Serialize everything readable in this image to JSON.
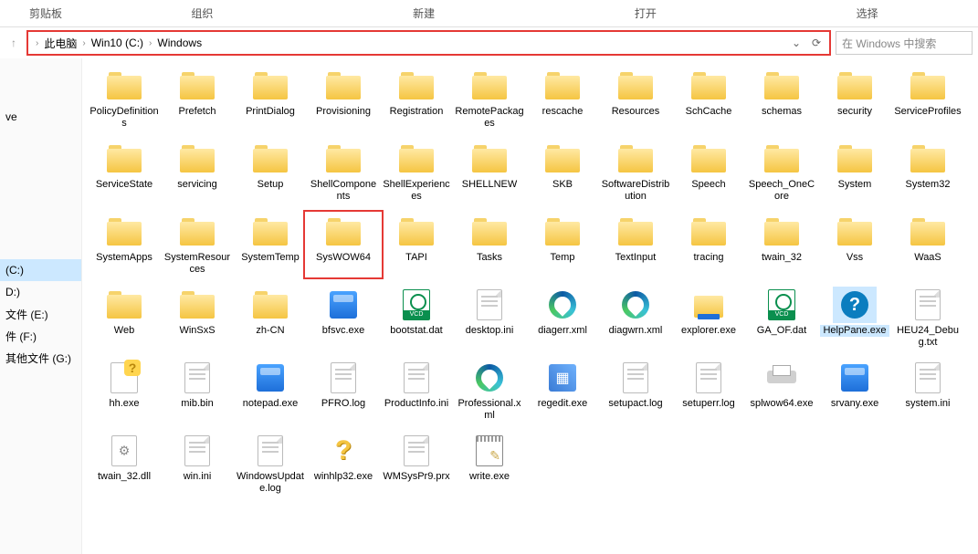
{
  "ribbon": {
    "left": "剪贴板",
    "groups": [
      "组织",
      "新建",
      "打开",
      "选择"
    ]
  },
  "nav": {
    "up": "↑"
  },
  "breadcrumb": [
    {
      "label": "此电脑"
    },
    {
      "label": "Win10 (C:)"
    },
    {
      "label": "Windows"
    }
  ],
  "search": {
    "placeholder": "在 Windows 中搜索"
  },
  "sidebar": [
    {
      "label": ""
    },
    {
      "label": ""
    },
    {
      "label": "ve"
    },
    {
      "label": ""
    },
    {
      "label": ""
    },
    {
      "label": ""
    },
    {
      "label": ""
    },
    {
      "label": ""
    },
    {
      "label": ""
    },
    {
      "label": "(C:)",
      "selected": true
    },
    {
      "label": "D:)"
    },
    {
      "label": "文件 (E:)"
    },
    {
      "label": "件 (F:)"
    },
    {
      "label": "其他文件 (G:)"
    }
  ],
  "items": [
    {
      "name": "PolicyDefinitions",
      "icon": "folder"
    },
    {
      "name": "Prefetch",
      "icon": "folder"
    },
    {
      "name": "PrintDialog",
      "icon": "folder"
    },
    {
      "name": "Provisioning",
      "icon": "folder"
    },
    {
      "name": "Registration",
      "icon": "folder"
    },
    {
      "name": "RemotePackages",
      "icon": "folder"
    },
    {
      "name": "rescache",
      "icon": "folder"
    },
    {
      "name": "Resources",
      "icon": "folder"
    },
    {
      "name": "SchCache",
      "icon": "folder"
    },
    {
      "name": "schemas",
      "icon": "folder"
    },
    {
      "name": "security",
      "icon": "folder"
    },
    {
      "name": "ServiceProfiles",
      "icon": "folder"
    },
    {
      "name": "ServiceState",
      "icon": "folder"
    },
    {
      "name": "servicing",
      "icon": "folder"
    },
    {
      "name": "Setup",
      "icon": "folder"
    },
    {
      "name": "ShellComponents",
      "icon": "folder"
    },
    {
      "name": "ShellExperiences",
      "icon": "folder"
    },
    {
      "name": "SHELLNEW",
      "icon": "folder"
    },
    {
      "name": "SKB",
      "icon": "folder"
    },
    {
      "name": "SoftwareDistribution",
      "icon": "folder"
    },
    {
      "name": "Speech",
      "icon": "folder"
    },
    {
      "name": "Speech_OneCore",
      "icon": "folder"
    },
    {
      "name": "System",
      "icon": "folder"
    },
    {
      "name": "System32",
      "icon": "folder"
    },
    {
      "name": "SystemApps",
      "icon": "folder"
    },
    {
      "name": "SystemResources",
      "icon": "folder"
    },
    {
      "name": "SystemTemp",
      "icon": "folder"
    },
    {
      "name": "SysWOW64",
      "icon": "folder",
      "highlight": true
    },
    {
      "name": "TAPI",
      "icon": "folder"
    },
    {
      "name": "Tasks",
      "icon": "folder"
    },
    {
      "name": "Temp",
      "icon": "folder"
    },
    {
      "name": "TextInput",
      "icon": "folder"
    },
    {
      "name": "tracing",
      "icon": "folder"
    },
    {
      "name": "twain_32",
      "icon": "folder"
    },
    {
      "name": "Vss",
      "icon": "folder"
    },
    {
      "name": "WaaS",
      "icon": "folder"
    },
    {
      "name": "Web",
      "icon": "folder"
    },
    {
      "name": "WinSxS",
      "icon": "folder"
    },
    {
      "name": "zh-CN",
      "icon": "folder"
    },
    {
      "name": "bfsvc.exe",
      "icon": "exe"
    },
    {
      "name": "bootstat.dat",
      "icon": "vcd"
    },
    {
      "name": "desktop.ini",
      "icon": "file"
    },
    {
      "name": "diagerr.xml",
      "icon": "edge"
    },
    {
      "name": "diagwrn.xml",
      "icon": "edge"
    },
    {
      "name": "explorer.exe",
      "icon": "expl"
    },
    {
      "name": "GA_OF.dat",
      "icon": "vcd"
    },
    {
      "name": "HelpPane.exe",
      "icon": "help",
      "selected": true
    },
    {
      "name": "HEU24_Debug.txt",
      "icon": "file"
    },
    {
      "name": "hh.exe",
      "icon": "hh"
    },
    {
      "name": "mib.bin",
      "icon": "file"
    },
    {
      "name": "notepad.exe",
      "icon": "exe"
    },
    {
      "name": "PFRO.log",
      "icon": "file"
    },
    {
      "name": "ProductInfo.ini",
      "icon": "file"
    },
    {
      "name": "Professional.xml",
      "icon": "edge"
    },
    {
      "name": "regedit.exe",
      "icon": "reg"
    },
    {
      "name": "setupact.log",
      "icon": "file"
    },
    {
      "name": "setuperr.log",
      "icon": "file"
    },
    {
      "name": "splwow64.exe",
      "icon": "printer"
    },
    {
      "name": "srvany.exe",
      "icon": "exe"
    },
    {
      "name": "system.ini",
      "icon": "file"
    },
    {
      "name": "twain_32.dll",
      "icon": "dll"
    },
    {
      "name": "win.ini",
      "icon": "file"
    },
    {
      "name": "WindowsUpdate.log",
      "icon": "file"
    },
    {
      "name": "winhlp32.exe",
      "icon": "q"
    },
    {
      "name": "WMSysPr9.prx",
      "icon": "file"
    },
    {
      "name": "write.exe",
      "icon": "write"
    }
  ]
}
